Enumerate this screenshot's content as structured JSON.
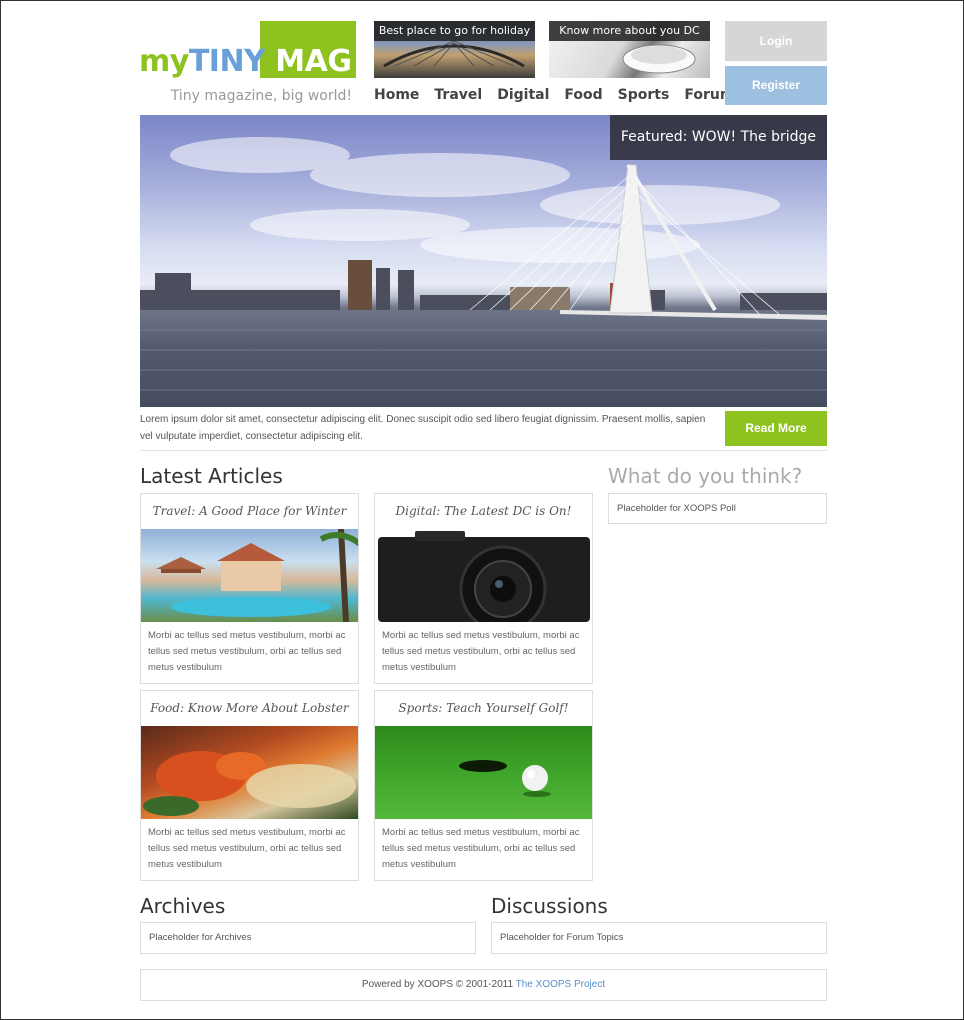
{
  "logo": {
    "part1": "my",
    "part2": "TINY",
    "part3": "MAG",
    "tagline": "Tiny magazine, big world!"
  },
  "thumbs": [
    {
      "caption": "Best place to go for holiday"
    },
    {
      "caption": "Know more about you DC"
    }
  ],
  "nav": [
    "Home",
    "Travel",
    "Digital",
    "Food",
    "Sports",
    "Forum"
  ],
  "auth": {
    "login": "Login",
    "register": "Register"
  },
  "hero": {
    "featured": "Featured: WOW! The bridge",
    "text": "Lorem ipsum dolor sit amet, consectetur adipiscing elit. Donec suscipit odio sed libero feugiat dignissim. Praesent mollis, sapien vel vulputate imperdiet, consectetur adipiscing elit.",
    "read_more": "Read More"
  },
  "latest": {
    "heading": "Latest Articles",
    "articles": [
      {
        "title": "Travel: A Good Place for Winter",
        "text": "Morbi ac tellus sed metus vestibulum, morbi ac tellus sed metus vestibulum, orbi ac tellus sed metus vestibulum"
      },
      {
        "title": "Digital: The Latest DC is On!",
        "text": "Morbi ac tellus sed metus vestibulum, morbi ac tellus sed metus vestibulum, orbi ac tellus sed metus vestibulum"
      },
      {
        "title": "Food: Know More About Lobster",
        "text": "Morbi ac tellus sed metus vestibulum, morbi ac tellus sed metus vestibulum, orbi ac tellus sed metus vestibulum"
      },
      {
        "title": "Sports: Teach Yourself Golf!",
        "text": "Morbi ac tellus sed metus vestibulum, morbi ac tellus sed metus vestibulum, orbi ac tellus sed metus vestibulum"
      }
    ]
  },
  "poll": {
    "heading": "What do you think?",
    "placeholder": "Placeholder for XOOPS Poll"
  },
  "archives": {
    "heading": "Archives",
    "placeholder": "Placeholder for Archives"
  },
  "discussions": {
    "heading": "Discussions",
    "placeholder": "Placeholder for Forum Topics"
  },
  "footer": {
    "text": "Powered by XOOPS © 2001-2011",
    "link": "The XOOPS Project"
  },
  "colors": {
    "accent_green": "#8dc21f",
    "accent_blue": "#9dbfe0",
    "logo_blue": "#6aa0d8"
  }
}
